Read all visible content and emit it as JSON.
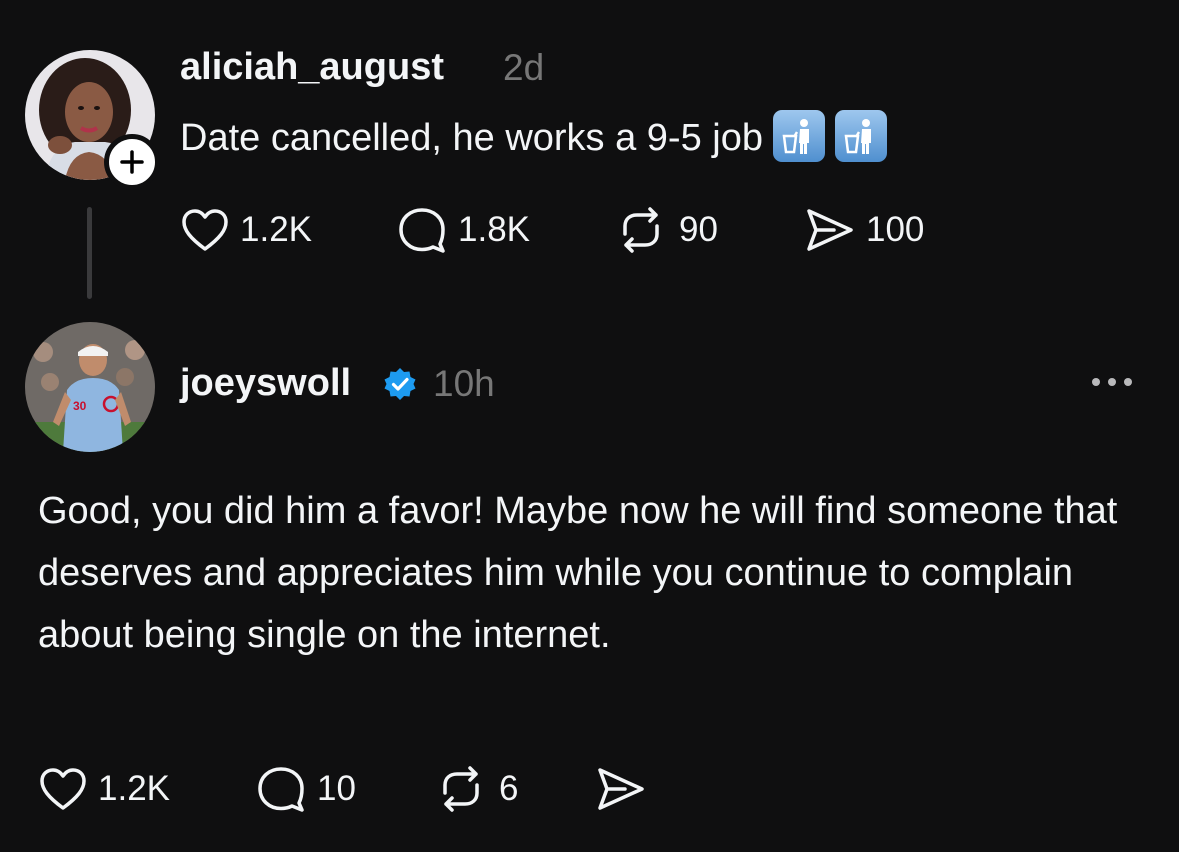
{
  "posts": [
    {
      "username": "aliciah_august",
      "timestamp": "2d",
      "text": "Date cancelled, he works a 9-5 job",
      "emoji": [
        "put-litter-in-its-place",
        "put-litter-in-its-place"
      ],
      "actions": {
        "likes": "1.2K",
        "replies": "1.8K",
        "reposts": "90",
        "shares": "100"
      },
      "follow_badge": "+"
    },
    {
      "username": "joeyswoll",
      "verified": true,
      "timestamp": "10h",
      "text": "Good, you did him a favor! Maybe now he will find someone that deserves and appreciates him while you continue to complain about being single on the internet.",
      "actions": {
        "likes": "1.2K",
        "replies": "10",
        "reposts": "6",
        "shares": ""
      }
    }
  ],
  "colors": {
    "background": "#0f0f10",
    "text": "#f3f5f7",
    "muted": "#777777",
    "verified": "#1d9bf0"
  }
}
